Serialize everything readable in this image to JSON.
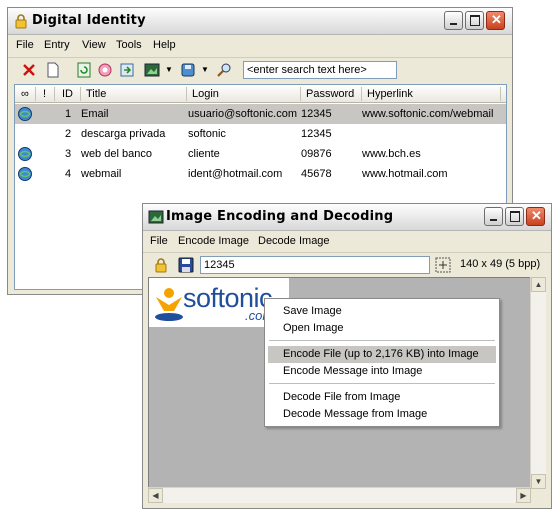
{
  "main_window": {
    "title": "Digital Identity",
    "menu": [
      "File",
      "Entry",
      "View",
      "Tools",
      "Help"
    ],
    "search_placeholder": "<enter search text here>",
    "columns": [
      "∞",
      "!",
      "ID",
      "Title",
      "Login",
      "Password",
      "Hyperlink"
    ],
    "rows": [
      {
        "id": "1",
        "title": "Email",
        "login": "usuario@softonic.com",
        "password": "12345",
        "hyperlink": "www.softonic.com/webmail",
        "icon": "globe-icon",
        "selected": true
      },
      {
        "id": "2",
        "title": "descarga privada",
        "login": "softonic",
        "password": "12345",
        "hyperlink": "",
        "icon": "",
        "selected": false
      },
      {
        "id": "3",
        "title": "web del banco",
        "login": "cliente",
        "password": "09876",
        "hyperlink": "www.bch.es",
        "icon": "globe-icon",
        "selected": false
      },
      {
        "id": "4",
        "title": "webmail",
        "login": "ident@hotmail.com",
        "password": "45678",
        "hyperlink": "www.hotmail.com",
        "icon": "globe-icon",
        "selected": false
      }
    ]
  },
  "encoder_window": {
    "title": "Image Encoding and Decoding",
    "menu": [
      "File",
      "Encode Image",
      "Decode Image"
    ],
    "password_value": "12345",
    "image_info": "140 x 49 (5 bpp)",
    "image_text": "softonic",
    "image_text_suffix": ".com"
  },
  "context_menu": {
    "items": [
      {
        "label": "Save Image",
        "highlighted": false
      },
      {
        "label": "Open Image",
        "highlighted": false
      },
      {
        "label": "Encode File (up to 2,176 KB) into Image",
        "highlighted": true
      },
      {
        "label": "Encode Message into Image",
        "highlighted": false
      },
      {
        "label": "Decode File from Image",
        "highlighted": false
      },
      {
        "label": "Decode Message from Image",
        "highlighted": false
      }
    ]
  },
  "colors": {
    "close_button": "#d4532e",
    "selection": "#c7c6c3",
    "softonic_blue": "#1f4f9c",
    "softonic_orange": "#f5a300"
  }
}
